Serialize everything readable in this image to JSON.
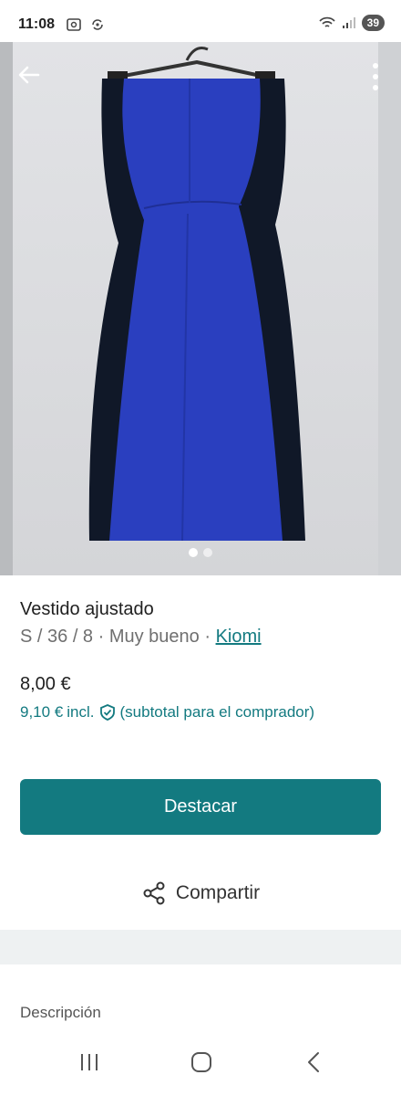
{
  "status_bar": {
    "time": "11:08",
    "battery": "39"
  },
  "listing": {
    "title": "Vestido ajustado",
    "meta": "S / 36 / 8 · Muy bueno · ",
    "brand": "Kiomi",
    "price": "8,00 €",
    "total_price": "9,10 €",
    "total_suffix": "incl.",
    "total_note": "(subtotal para el comprador)"
  },
  "actions": {
    "highlight_label": "Destacar",
    "share_label": "Compartir"
  },
  "description": {
    "heading": "Descripción"
  },
  "gallery": {
    "photo_count": 2,
    "active_index": 0
  },
  "colors": {
    "accent": "#137a80",
    "dress_blue": "#2a3fbf",
    "dress_black": "#101828"
  }
}
